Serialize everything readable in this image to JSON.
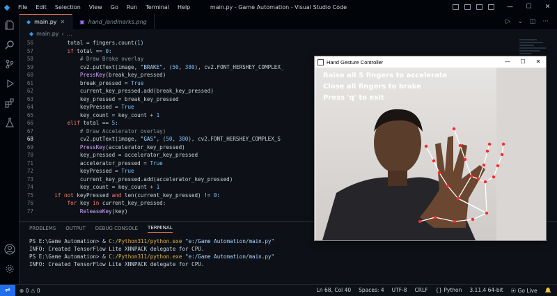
{
  "window": {
    "title": "main.py - Game Automation - Visual Studio Code",
    "menu": [
      "File",
      "Edit",
      "Selection",
      "View",
      "Go",
      "Run",
      "Terminal",
      "Help"
    ],
    "controls": [
      "—",
      "☐",
      "✕"
    ]
  },
  "tabs": [
    {
      "label": "main.py",
      "icon": "python-file-icon",
      "active": true
    },
    {
      "label": "hand_landmarks.png",
      "icon": "image-file-icon",
      "active": false
    }
  ],
  "breadcrumb": "main.py",
  "editor": {
    "current_line": 68,
    "lines": [
      {
        "n": 56,
        "i": 2,
        "t": [
          [
            "",
            "total = fingers.count("
          ],
          [
            "nm",
            "1"
          ],
          [
            "",
            ")"
          ]
        ]
      },
      {
        "n": 57,
        "i": 2,
        "t": [
          [
            "kw",
            "if "
          ],
          [
            "",
            "total == "
          ],
          [
            "nm",
            "0"
          ],
          [
            "",
            ":"
          ]
        ]
      },
      {
        "n": 58,
        "i": 3,
        "t": [
          [
            "cm",
            "# Draw Brake overlay"
          ]
        ]
      },
      {
        "n": 59,
        "i": 3,
        "t": [
          [
            "",
            "cv2.putText(image, "
          ],
          [
            "st",
            "\"BRAKE\""
          ],
          [
            "",
            ", ("
          ],
          [
            "nm",
            "50"
          ],
          [
            "",
            ", "
          ],
          [
            "nm",
            "380"
          ],
          [
            "",
            "), cv2.FONT_HERSHEY_COMPLEX_"
          ]
        ]
      },
      {
        "n": 60,
        "i": 3,
        "t": [
          [
            "fn",
            "PressKey"
          ],
          [
            "",
            "(break_key_pressed)"
          ]
        ]
      },
      {
        "n": 61,
        "i": 3,
        "t": [
          [
            "",
            "break_pressed = "
          ],
          [
            "nm",
            "True"
          ]
        ]
      },
      {
        "n": 62,
        "i": 3,
        "t": [
          [
            "",
            "current_key_pressed.add(break_key_pressed)"
          ]
        ]
      },
      {
        "n": 63,
        "i": 3,
        "t": [
          [
            "",
            "key_pressed = break_key_pressed"
          ]
        ]
      },
      {
        "n": 64,
        "i": 3,
        "t": [
          [
            "",
            "keyPressed = "
          ],
          [
            "nm",
            "True"
          ]
        ]
      },
      {
        "n": 65,
        "i": 3,
        "t": [
          [
            "",
            "key_count = key_count + "
          ],
          [
            "nm",
            "1"
          ]
        ]
      },
      {
        "n": 66,
        "i": 2,
        "t": [
          [
            "kw",
            "elif "
          ],
          [
            "",
            "total == "
          ],
          [
            "nm",
            "5"
          ],
          [
            "",
            ":"
          ]
        ]
      },
      {
        "n": 67,
        "i": 3,
        "t": [
          [
            "cm",
            "# Draw Accelerator overlay)"
          ]
        ]
      },
      {
        "n": 68,
        "i": 3,
        "t": [
          [
            "",
            "cv2.putText(image, "
          ],
          [
            "st",
            "\"GAS\""
          ],
          [
            "",
            ", ("
          ],
          [
            "nm",
            "50"
          ],
          [
            "",
            ", "
          ],
          [
            "nm",
            "380"
          ],
          [
            "",
            "), cv2.FONT_HERSHEY_COMPLEX_S"
          ]
        ]
      },
      {
        "n": 69,
        "i": 3,
        "t": [
          [
            "fn",
            "PressKey"
          ],
          [
            "",
            "(accelerator_key_pressed)"
          ]
        ]
      },
      {
        "n": 70,
        "i": 3,
        "t": [
          [
            "",
            "key_pressed = accelerator_key_pressed"
          ]
        ]
      },
      {
        "n": 71,
        "i": 3,
        "t": [
          [
            "",
            "accelerator_pressed = "
          ],
          [
            "nm",
            "True"
          ]
        ]
      },
      {
        "n": 72,
        "i": 3,
        "t": [
          [
            "",
            "keyPressed = "
          ],
          [
            "nm",
            "True"
          ]
        ]
      },
      {
        "n": 73,
        "i": 3,
        "t": [
          [
            "",
            "current_key_pressed.add(accelerator_key_pressed)"
          ]
        ]
      },
      {
        "n": 74,
        "i": 3,
        "t": [
          [
            "",
            "key_count = key_count + "
          ],
          [
            "nm",
            "1"
          ]
        ]
      },
      {
        "n": 75,
        "i": 1,
        "t": [
          [
            "kw",
            "if not "
          ],
          [
            "",
            "keyPressed "
          ],
          [
            "kw",
            "and "
          ],
          [
            "",
            "len(current_key_pressed) != "
          ],
          [
            "nm",
            "0"
          ],
          [
            "",
            ":"
          ]
        ]
      },
      {
        "n": 76,
        "i": 2,
        "t": [
          [
            "kw",
            "for "
          ],
          [
            "",
            "key "
          ],
          [
            "kw",
            "in "
          ],
          [
            "",
            "current_key_pressed:"
          ]
        ]
      },
      {
        "n": 77,
        "i": 3,
        "t": [
          [
            "fn",
            "ReleaseKey"
          ],
          [
            "",
            "(key)"
          ]
        ]
      }
    ]
  },
  "panel": {
    "tabs": [
      "PROBLEMS",
      "OUTPUT",
      "DEBUG CONSOLE",
      "TERMINAL"
    ],
    "active_tab": "TERMINAL",
    "terminal": [
      {
        "prompt": "PS E:\\Game Automation> & ",
        "cmd": "C:/Python311/python.exe",
        "arg": " \"e:/Game Automation/main.py\""
      },
      {
        "text": "INFO: Created TensorFlow Lite XNNPACK delegate for CPU."
      },
      {
        "prompt": "PS E:\\Game Automation> & ",
        "cmd": "C:/Python311/python.exe",
        "arg": " \"e:/Game Automation/main.py\""
      },
      {
        "text": "INFO: Created TensorFlow Lite XNNPACK delegate for CPU."
      }
    ]
  },
  "status": {
    "problems": "⊗ 0 ⚠ 0",
    "position": "Ln 68, Col 40",
    "spaces": "Spaces: 4",
    "encoding": "UTF-8",
    "eol": "CRLF",
    "language": "{} Python",
    "interpreter": "3.11.4 64-bit",
    "golive": "⦿ Go Live"
  },
  "popup": {
    "title": "Hand Gesture Controller",
    "controls": [
      "—",
      "☐",
      "✕"
    ],
    "overlay": [
      "Raise all 5 fingers to accelerate",
      "Close all fingers to brake",
      "Press 'q' to exit"
    ]
  },
  "colors": {
    "accent": "#1f6feb",
    "landmark": "#ff2a2a",
    "connection": "#ffffff"
  }
}
